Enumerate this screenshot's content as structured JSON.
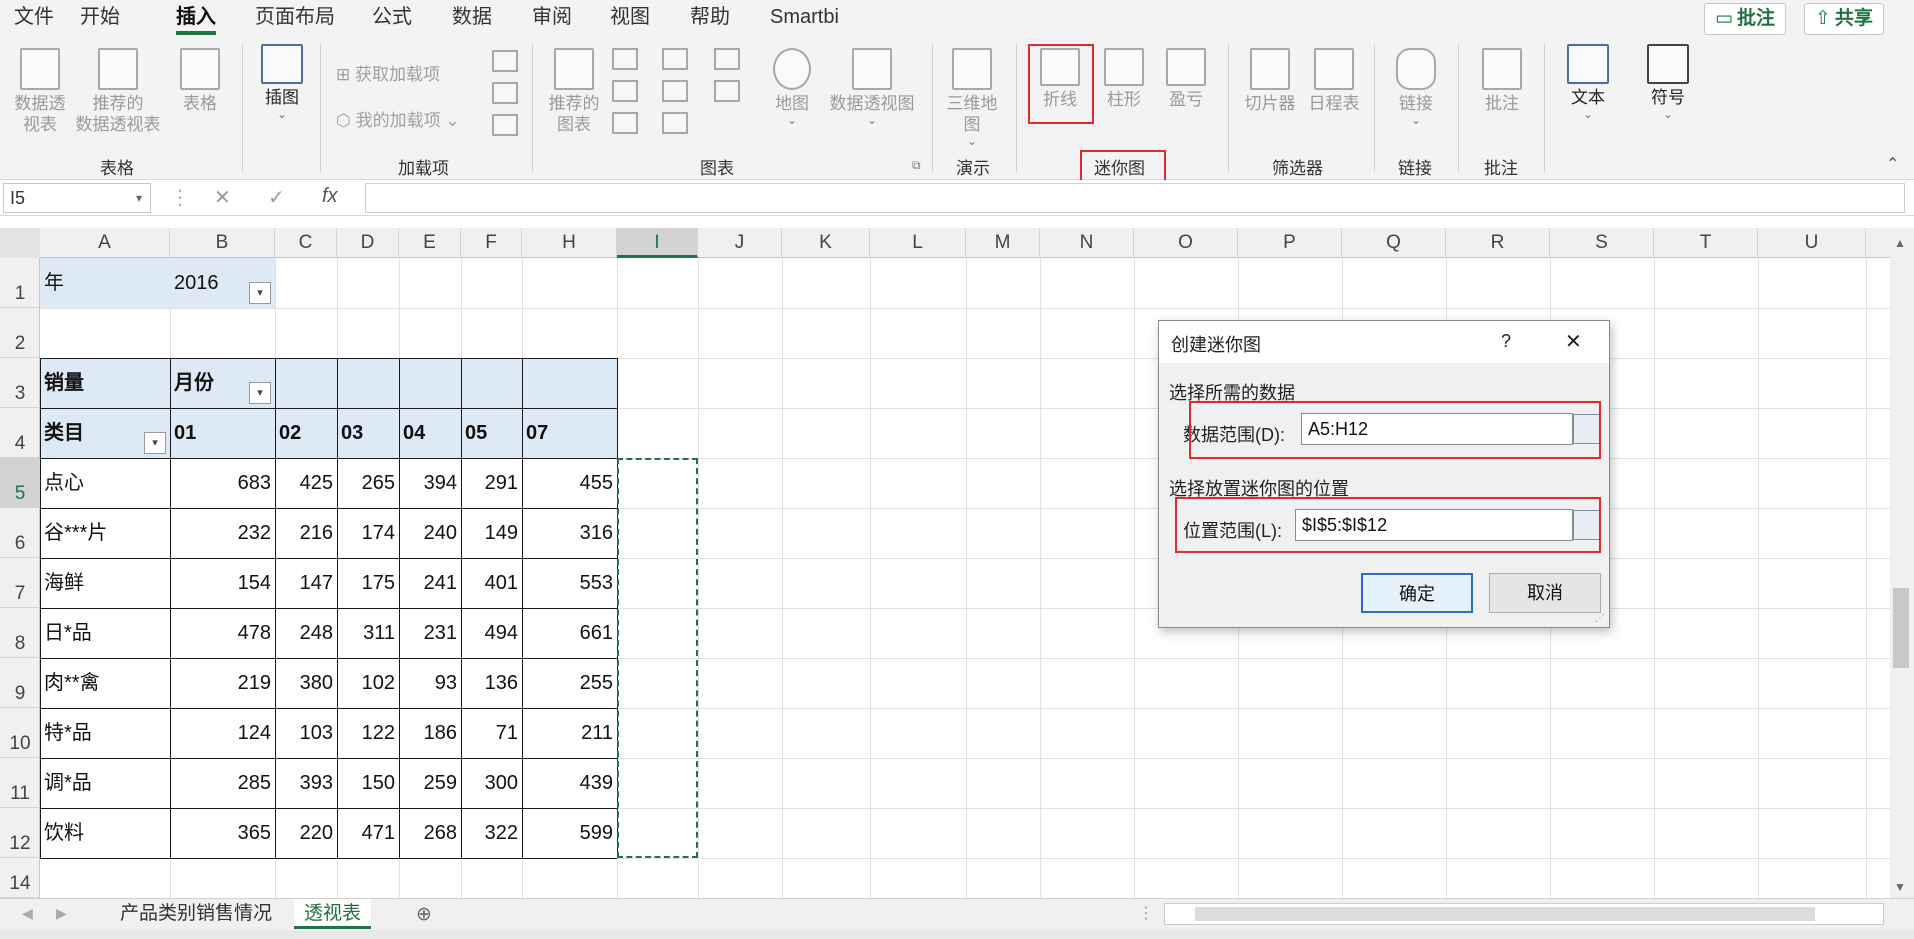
{
  "menu": {
    "tabs": [
      "文件",
      "开始",
      "插入",
      "页面布局",
      "公式",
      "数据",
      "审阅",
      "视图",
      "帮助",
      "Smartbi"
    ],
    "active_tab": "插入",
    "comment_button": "批注",
    "share_button": "共享"
  },
  "ribbon": {
    "pivot": "数据透\n视表",
    "recommended_pivot": "推荐的\n数据透视表",
    "table": "表格",
    "table_group": "表格",
    "illustration": "插图",
    "get_addins": "获取加载项",
    "my_addins": "我的加载项",
    "addins_group": "加载项",
    "recommended_charts": "推荐的\n图表",
    "map": "地图",
    "pivot_chart": "数据透视图",
    "charts_group": "图表",
    "map3d": "三维地\n图",
    "tours_group": "演示",
    "spark_line": "折线",
    "spark_column": "柱形",
    "spark_winloss": "盈亏",
    "sparklines_group": "迷你图",
    "slicer": "切片器",
    "timeline": "日程表",
    "filters_group": "筛选器",
    "link": "链接",
    "links_group": "链接",
    "comment": "批注",
    "comments_group": "批注",
    "text": "文本",
    "symbol": "符号"
  },
  "formula_bar": {
    "name_box": "I5",
    "formula": ""
  },
  "grid": {
    "columns": [
      "A",
      "B",
      "C",
      "D",
      "E",
      "F",
      "H",
      "I",
      "J",
      "K",
      "L",
      "M",
      "N",
      "O",
      "P",
      "Q",
      "R",
      "S",
      "T",
      "U"
    ],
    "rows": [
      "1",
      "2",
      "3",
      "4",
      "5",
      "6",
      "7",
      "8",
      "9",
      "10",
      "11",
      "12",
      "14"
    ],
    "selected_column": "I",
    "selected_row": "5"
  },
  "pivot": {
    "filter_label": "年",
    "filter_value": "2016",
    "values_label": "销量",
    "col_field": "月份",
    "row_field": "类目",
    "months": [
      "01",
      "02",
      "03",
      "04",
      "05",
      "07"
    ],
    "rows": [
      {
        "category": "点心",
        "values": [
          "683",
          "425",
          "265",
          "394",
          "291",
          "455"
        ]
      },
      {
        "category": "谷***片",
        "values": [
          "232",
          "216",
          "174",
          "240",
          "149",
          "316"
        ]
      },
      {
        "category": "海鲜",
        "values": [
          "154",
          "147",
          "175",
          "241",
          "401",
          "553"
        ]
      },
      {
        "category": "日*品",
        "values": [
          "478",
          "248",
          "311",
          "231",
          "494",
          "661"
        ]
      },
      {
        "category": "肉**禽",
        "values": [
          "219",
          "380",
          "102",
          "93",
          "136",
          "255"
        ]
      },
      {
        "category": "特*品",
        "values": [
          "124",
          "103",
          "122",
          "186",
          "71",
          "211"
        ]
      },
      {
        "category": "调*品",
        "values": [
          "285",
          "393",
          "150",
          "259",
          "300",
          "439"
        ]
      },
      {
        "category": "饮料",
        "values": [
          "365",
          "220",
          "471",
          "268",
          "322",
          "599"
        ]
      }
    ]
  },
  "sheets": {
    "tabs": [
      "产品类别销售情况",
      "透视表"
    ],
    "active": "透视表"
  },
  "dialog": {
    "title": "创建迷你图",
    "help": "?",
    "close": "✕",
    "section_data": "选择所需的数据",
    "data_range_label": "数据范围(D):",
    "data_range_value": "A5:H12",
    "section_location": "选择放置迷你图的位置",
    "location_label": "位置范围(L):",
    "location_value": "$I$5:$I$12",
    "ok": "确定",
    "cancel": "取消"
  },
  "colors": {
    "accent": "#217346",
    "highlight_red": "#e02b2b",
    "pivot_header_bg": "#dde9f5"
  }
}
